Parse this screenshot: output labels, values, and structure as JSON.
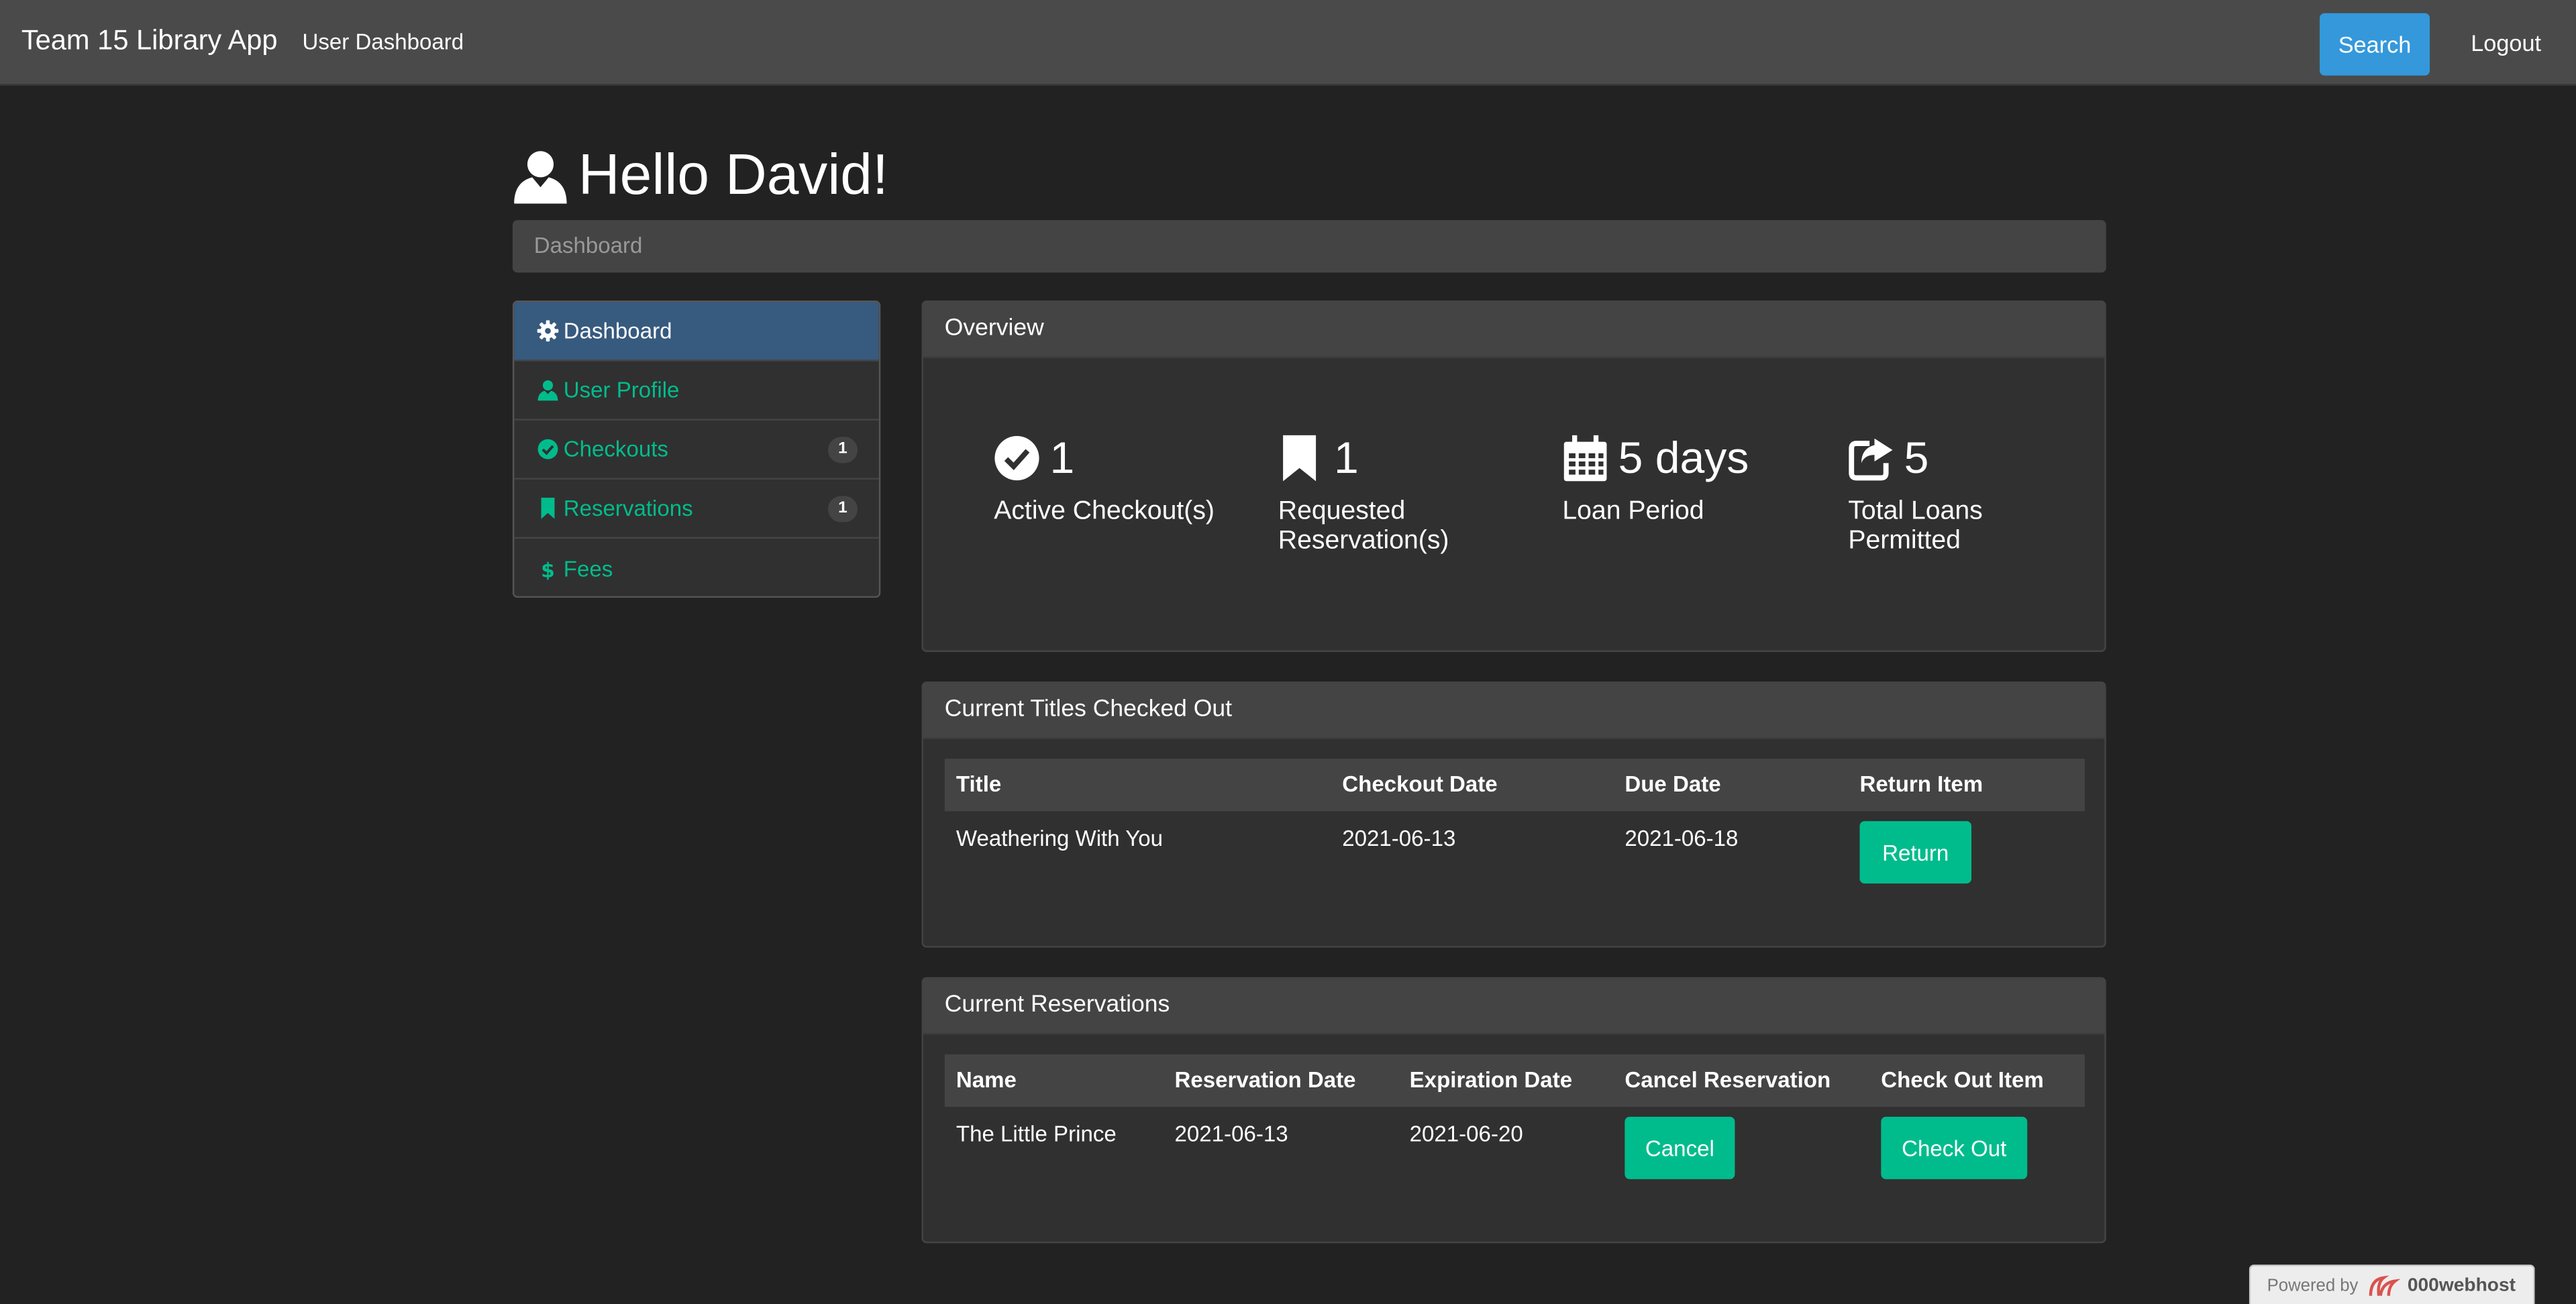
{
  "navbar": {
    "brand": "Team 15 Library App",
    "link": "User Dashboard",
    "search_label": "Search",
    "logout_label": "Logout"
  },
  "greeting": "Hello David!",
  "breadcrumb": "Dashboard",
  "sidebar": {
    "items": [
      {
        "label": "Dashboard",
        "icon": "gear-icon",
        "active": true
      },
      {
        "label": "User Profile",
        "icon": "user-icon"
      },
      {
        "label": "Checkouts",
        "icon": "check-circle-icon",
        "badge": "1"
      },
      {
        "label": "Reservations",
        "icon": "bookmark-icon",
        "badge": "1"
      },
      {
        "label": "Fees",
        "icon": "dollar-icon"
      }
    ]
  },
  "overview": {
    "title": "Overview",
    "stats": [
      {
        "value": "1",
        "label": "Active Checkout(s)",
        "icon": "check-circle-icon"
      },
      {
        "value": "1",
        "label": "Requested Reservation(s)",
        "icon": "bookmark-icon"
      },
      {
        "value": "5 days",
        "label": "Loan Period",
        "icon": "calendar-icon"
      },
      {
        "value": "5",
        "label": "Total Loans Permitted",
        "icon": "share-icon"
      }
    ]
  },
  "checkouts": {
    "title": "Current Titles Checked Out",
    "headers": [
      "Title",
      "Checkout Date",
      "Due Date",
      "Return Item"
    ],
    "rows": [
      {
        "title": "Weathering With You",
        "checkout_date": "2021-06-13",
        "due_date": "2021-06-18",
        "action": "Return"
      }
    ]
  },
  "reservations": {
    "title": "Current Reservations",
    "headers": [
      "Name",
      "Reservation Date",
      "Expiration Date",
      "Cancel Reservation",
      "Check Out Item"
    ],
    "rows": [
      {
        "name": "The Little Prince",
        "reservation_date": "2021-06-13",
        "expiration_date": "2021-06-20",
        "cancel": "Cancel",
        "checkout": "Check Out"
      }
    ]
  },
  "footer_badge": {
    "prefix": "Powered by",
    "host": "000webhost"
  },
  "colors": {
    "accent": "#00bc8c",
    "primary": "#375a7f",
    "search": "#3498db",
    "background": "#222222"
  }
}
